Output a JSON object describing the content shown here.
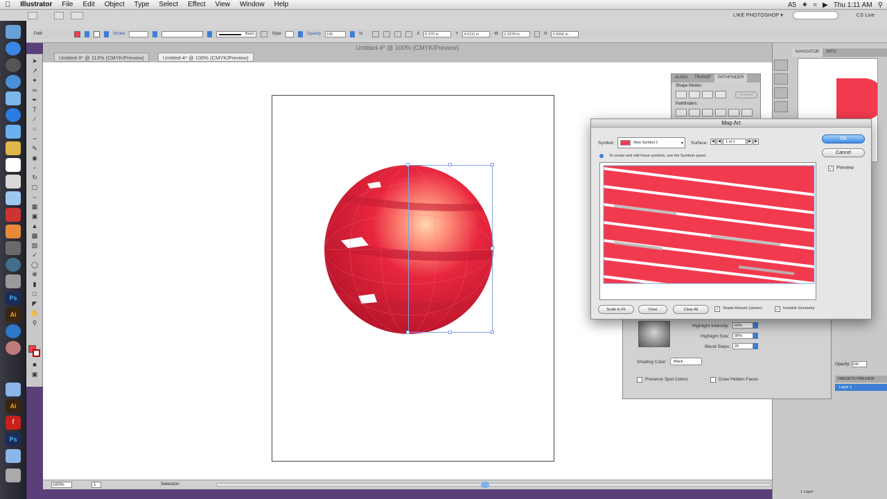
{
  "menubar": {
    "apple": "",
    "app": "Illustrator",
    "items": [
      "File",
      "Edit",
      "Object",
      "Type",
      "Select",
      "Effect",
      "View",
      "Window",
      "Help"
    ],
    "status_right": {
      "a5": "A5",
      "time": "Thu 1:11 AM"
    }
  },
  "appbar": {
    "workspace": "LIKE PHOTOSHOP ▾",
    "cs_live": "CS Live"
  },
  "control": {
    "selection_type": "Path",
    "stroke_label": "Stroke",
    "basic_label": "Basic",
    "style_label": "Style",
    "opacity_label": "Opacity",
    "opacity_value": "100",
    "opacity_unit": "%",
    "x_label": "X",
    "x_value": "5.375 in",
    "y_label": "Y",
    "y_value": "4.6111 in",
    "w_label": "W",
    "w_value": "2.3278 in",
    "h_label": "H",
    "h_value": "3.0556 in"
  },
  "document": {
    "window_title": "Untitled-4* @ 100% (CMYK/Preview)",
    "tabs": [
      "Untitled-3* @ 113% (CMYK/Preview)",
      "Untitled-4* @ 100% (CMYK/Preview)"
    ]
  },
  "status": {
    "zoom": "100%",
    "page": "1",
    "mode": "Selection"
  },
  "panels": {
    "navigator_tabs": [
      "NAVIGATOR",
      "INFO"
    ],
    "pathfinder_tabs": [
      "ALIGN",
      "TRANSF",
      "PATHFINDER"
    ],
    "shape_modes_label": "Shape Modes:",
    "pathfinders_label": "Pathfinders:",
    "expand_label": "Expand",
    "layers_opacity_label": "Opacity:",
    "layers_opacity_value": "100",
    "layers_tab": "PRESETS PREVIEW",
    "layer_name": "Layer 1",
    "layers_count": "1 Layer"
  },
  "options3d": {
    "highlight_intensity_label": "Highlight Intensity:",
    "highlight_intensity_value": "60%",
    "highlight_size_label": "Highlight Size:",
    "highlight_size_value": "90%",
    "blend_steps_label": "Blend Steps:",
    "blend_steps_value": "25",
    "shading_color_label": "Shading Color:",
    "shading_color_value": "Black",
    "preserve_spot_label": "Preserve Spot Colors",
    "draw_hidden_label": "Draw Hidden Faces"
  },
  "mapart": {
    "title": "Map Art",
    "symbol_label": "Symbol:",
    "symbol_value": "New Symbol 1",
    "surface_label": "Surface:",
    "surface_value": "1 of 1",
    "hint": "To create and edit these symbols, use the Symbols panel.",
    "ok": "OK",
    "cancel": "Cancel",
    "preview_label": "Preview",
    "preview_checked": true,
    "scale_to_fit": "Scale to Fit",
    "clear": "Clear",
    "clear_all": "Clear All",
    "shade_artwork": "Shade Artwork (slower)",
    "invisible_geometry": "Invisible Geometry"
  },
  "colors": {
    "accent_red": "#f23a4e",
    "ok_blue": "#3d8ce8",
    "canvas": "#ffffff"
  }
}
